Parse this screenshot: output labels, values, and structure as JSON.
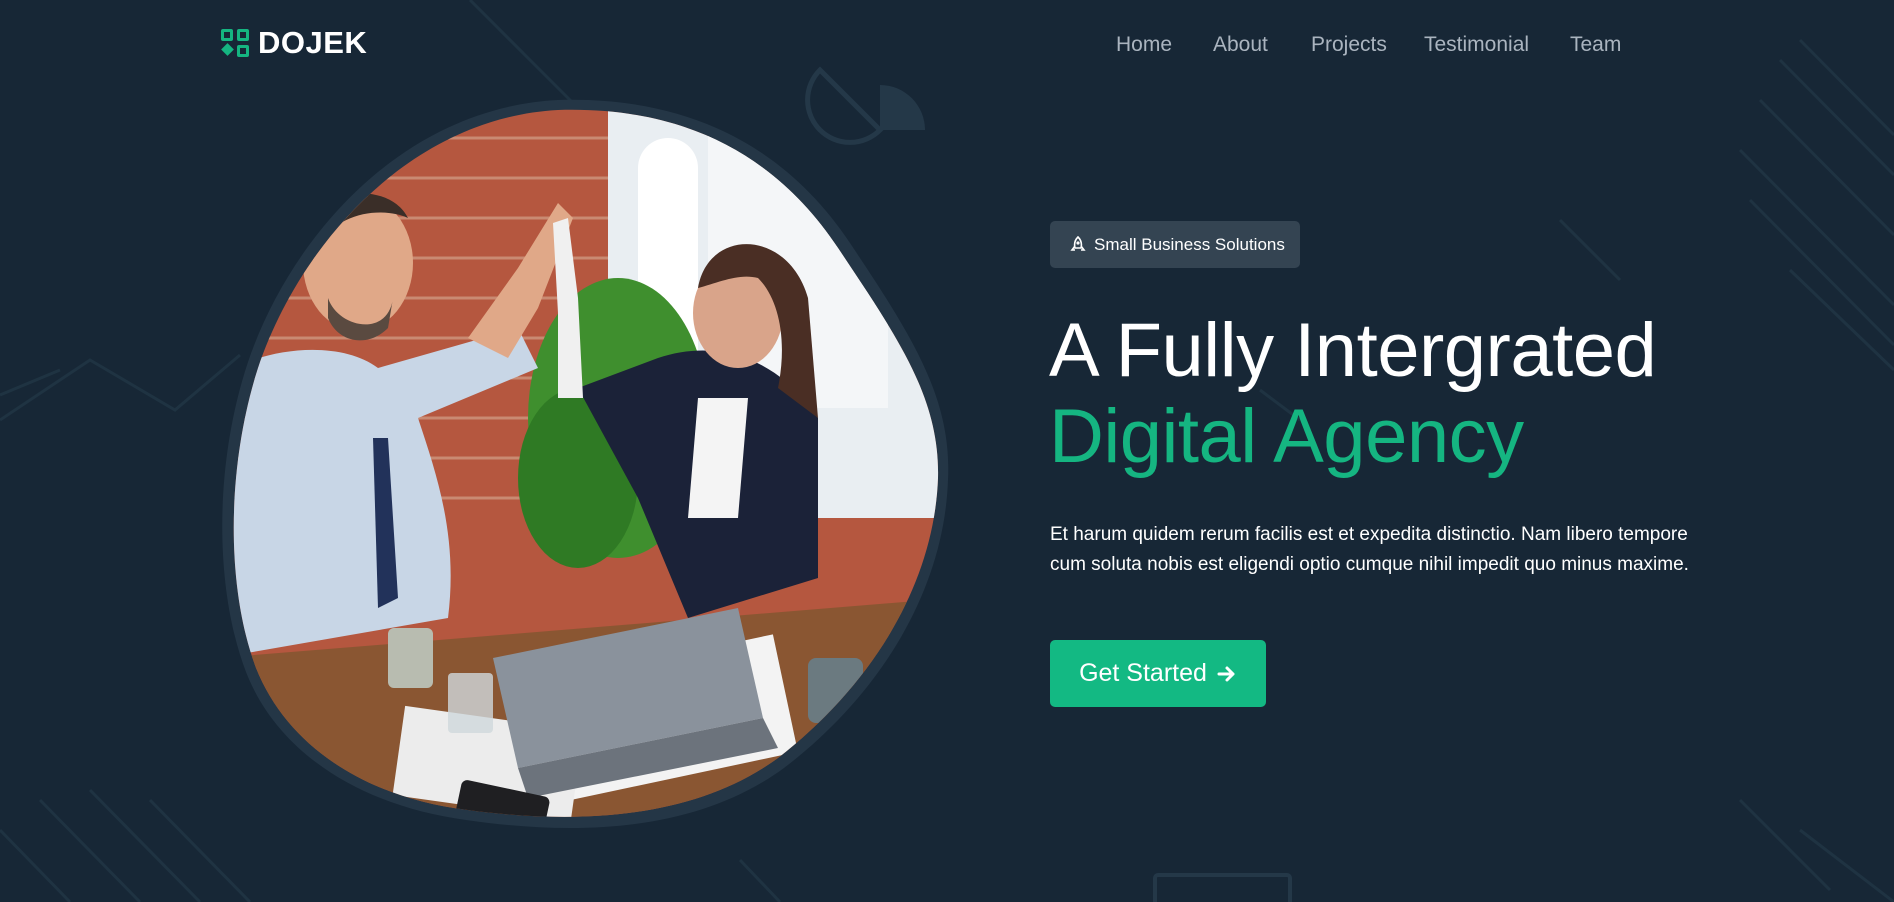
{
  "brand": {
    "name": "DOJEK",
    "logo_icon": "grid-logo-icon",
    "accent": "#15b581"
  },
  "nav": {
    "items": [
      "Home",
      "About",
      "Projects",
      "Testimonial",
      "Team"
    ]
  },
  "hero": {
    "badge_icon": "rocket-icon",
    "badge": "Small Business Solutions",
    "title_line1": "A Fully Intergrated",
    "title_line2": "Digital Agency",
    "description": "Et harum quidem rerum facilis est et expedita distinctio. Nam libero tempore cum soluta nobis est eligendi optio cumque nihil impedit quo minus maxime.",
    "cta_label": "Get Started",
    "cta_icon": "arrow-right-icon",
    "image_alt": "business-people-high-five-photo"
  },
  "colors": {
    "background": "#172736",
    "badge_bg": "#344452",
    "button": "#13b983",
    "nav_text": "#aab4bf"
  }
}
